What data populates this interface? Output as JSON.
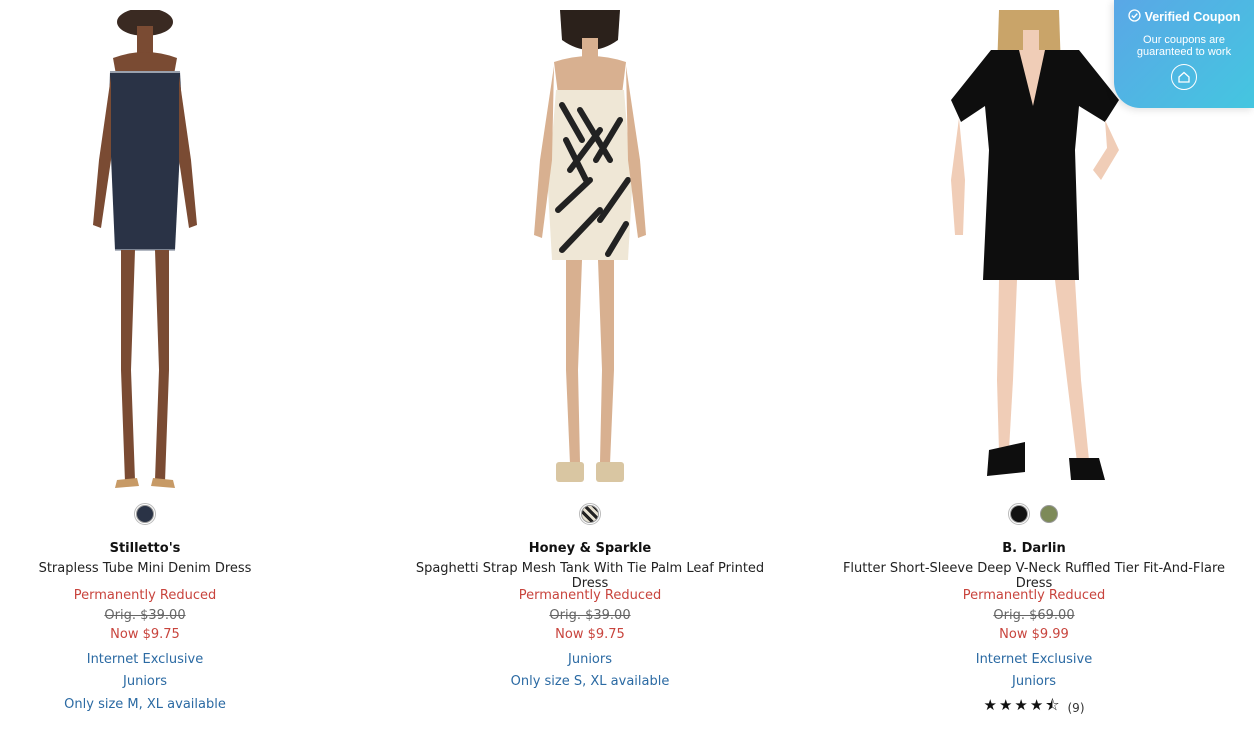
{
  "products": [
    {
      "brand": "Stilletto's",
      "title": "Strapless Tube Mini Denim Dress",
      "status": "Permanently Reduced",
      "orig": "Orig. $39.00",
      "now": "Now $9.75",
      "swatches": [
        "#2a3346"
      ],
      "lines": [
        "Internet Exclusive",
        "Juniors",
        "Only size M, XL available"
      ]
    },
    {
      "brand": "Honey & Sparkle",
      "title": "Spaghetti Strap Mesh Tank With Tie Palm Leaf Printed Dress",
      "status": "Permanently Reduced",
      "orig": "Orig. $39.00",
      "now": "Now $9.75",
      "swatches": [
        "#6d6a60"
      ],
      "lines": [
        "Juniors",
        "Only size S, XL available"
      ]
    },
    {
      "brand": "B. Darlin",
      "title": "Flutter Short-Sleeve Deep V-Neck Ruffled Tier Fit-And-Flare Dress",
      "status": "Permanently Reduced",
      "orig": "Orig. $69.00",
      "now": "Now $9.99",
      "swatches": [
        "#111111",
        "#7d8a59"
      ],
      "lines": [
        "Internet Exclusive",
        "Juniors"
      ],
      "rating": {
        "stars": "★★★★⯪",
        "count": "(9)"
      }
    }
  ],
  "coupon": {
    "title": "Verified Coupon",
    "subtitle": "Our coupons are guaranteed to work",
    "icons": [
      "check-circle-icon",
      "home-icon"
    ]
  }
}
